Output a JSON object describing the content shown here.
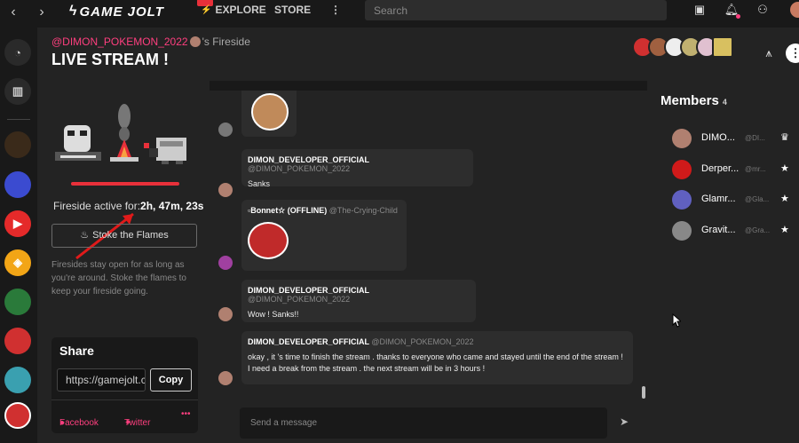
{
  "topbar": {
    "logo": "GAME JOLT",
    "nav": [
      {
        "label": "EXPLORE"
      },
      {
        "label": "STORE"
      }
    ],
    "search_placeholder": "Search"
  },
  "header": {
    "owner_username": "@DIMON_POKEMON_2022",
    "owner_suffix": "'s Fireside",
    "title": "LIVE STREAM !"
  },
  "fireside": {
    "active_label": "Fireside active for:",
    "active_time": "2h, 47m, 23s",
    "stoke_button": "Stoke the Flames",
    "note": "Firesides stay open for as long as you're around. Stoke the flames to keep your fireside going."
  },
  "share": {
    "title": "Share",
    "url": "https://gamejolt.com/c/",
    "copy_label": "Copy",
    "facebook_label": "Facebook",
    "twitter_label": "Twitter",
    "more_label": "•••"
  },
  "chat": {
    "messages": [
      {
        "author": "DIMON_DEVELOPER_OFFICIAL",
        "handle": "@DIMON_POKEMON_2022",
        "text": "Sanks"
      },
      {
        "author": "▫Bonnet☆ (OFFLINE)",
        "handle": "@The-Crying-Child",
        "text": ""
      },
      {
        "author": "DIMON_DEVELOPER_OFFICIAL",
        "handle": "@DIMON_POKEMON_2022",
        "text": "Wow ! Sanks!!"
      },
      {
        "author": "DIMON_DEVELOPER_OFFICIAL",
        "handle": "@DIMON_POKEMON_2022",
        "text": "okay , it 's time to finish the stream . thanks to everyone who came and stayed until the end of the stream ! I need a break from the stream . the next stream will be in 3 hours !"
      }
    ],
    "input_placeholder": "Send a message"
  },
  "members": {
    "title": "Members",
    "count": "4",
    "list": [
      {
        "name": "DIMO...",
        "handle": "@DI...",
        "badge": "crown-icon"
      },
      {
        "name": "Derper...",
        "handle": "@mr...",
        "badge": "star-icon"
      },
      {
        "name": "Glamr...",
        "handle": "@Gla...",
        "badge": "star-icon"
      },
      {
        "name": "Gravit...",
        "handle": "@Gra...",
        "badge": "star-icon"
      }
    ]
  },
  "colors": {
    "accent": "#ff3f7f",
    "flame": "#e8303a",
    "background": "#191919",
    "panel": "#232323"
  }
}
